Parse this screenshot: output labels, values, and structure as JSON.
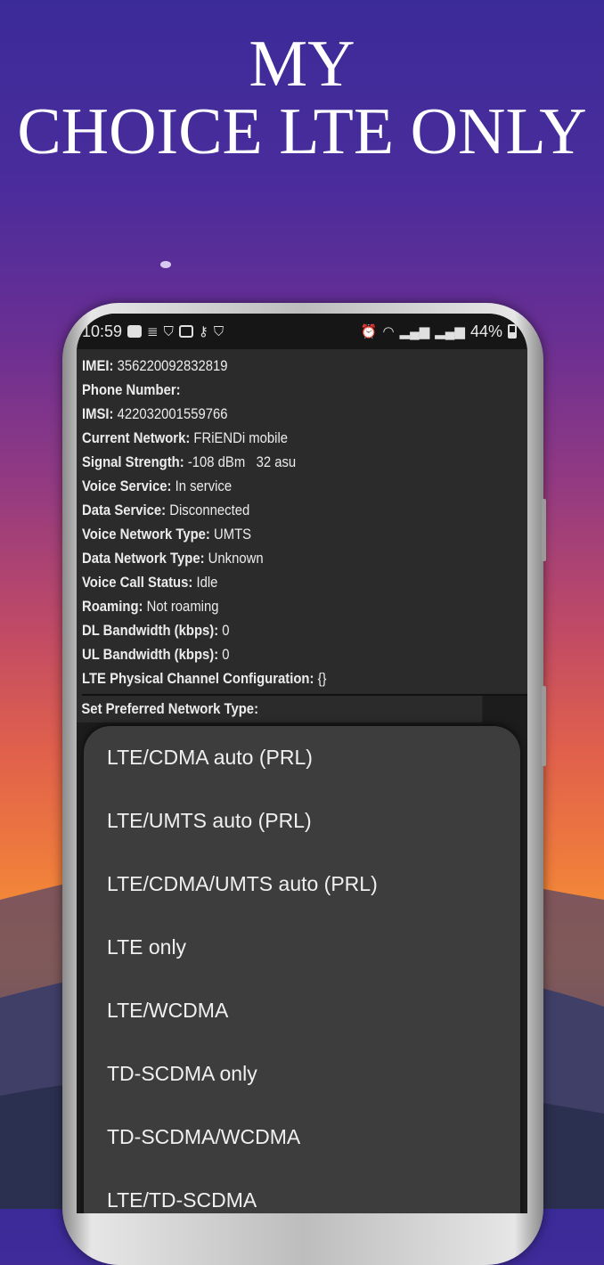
{
  "headline": {
    "line1": "MY",
    "line2": "CHOICE LTE ONLY"
  },
  "status_bar": {
    "time": "10:59",
    "battery": "44%",
    "left_icons": [
      "youtube-icon",
      "news-icon",
      "shield-check-icon",
      "image-icon",
      "vpn-key-icon",
      "shield-icon"
    ],
    "right_icons": [
      "alarm-icon",
      "wifi-icon",
      "signal-icon",
      "signal-icon",
      "battery-icon"
    ]
  },
  "info": [
    {
      "label": "IMEI:",
      "value": "356220092832819"
    },
    {
      "label": "Phone Number:",
      "value": ""
    },
    {
      "label": "IMSI:",
      "value": "422032001559766"
    },
    {
      "label": "Current Network:",
      "value": "FRiENDi mobile"
    },
    {
      "label": "Signal Strength:",
      "value": "-108 dBm   32 asu"
    },
    {
      "label": "Voice Service:",
      "value": "In service"
    },
    {
      "label": "Data Service:",
      "value": "Disconnected"
    },
    {
      "label": "Voice Network Type:",
      "value": "UMTS"
    },
    {
      "label": "Data Network Type:",
      "value": "Unknown"
    },
    {
      "label": "Voice Call Status:",
      "value": "Idle"
    },
    {
      "label": "Roaming:",
      "value": "Not roaming"
    },
    {
      "label": "DL Bandwidth (kbps):",
      "value": "0"
    },
    {
      "label": "UL Bandwidth (kbps):",
      "value": "0"
    },
    {
      "label": "LTE Physical Channel Configuration:",
      "value": "{}"
    }
  ],
  "preferred_label": "Set Preferred Network Type:",
  "network_options": [
    "LTE/CDMA auto (PRL)",
    "LTE/UMTS auto (PRL)",
    "LTE/CDMA/UMTS auto (PRL)",
    "LTE only",
    "LTE/WCDMA",
    "TD-SCDMA only",
    "TD-SCDMA/WCDMA",
    "LTE/TD-SCDMA"
  ],
  "colors": {
    "dialog": "#3d3d3d",
    "screen": "#2b2b2b",
    "text": "#ececec"
  }
}
